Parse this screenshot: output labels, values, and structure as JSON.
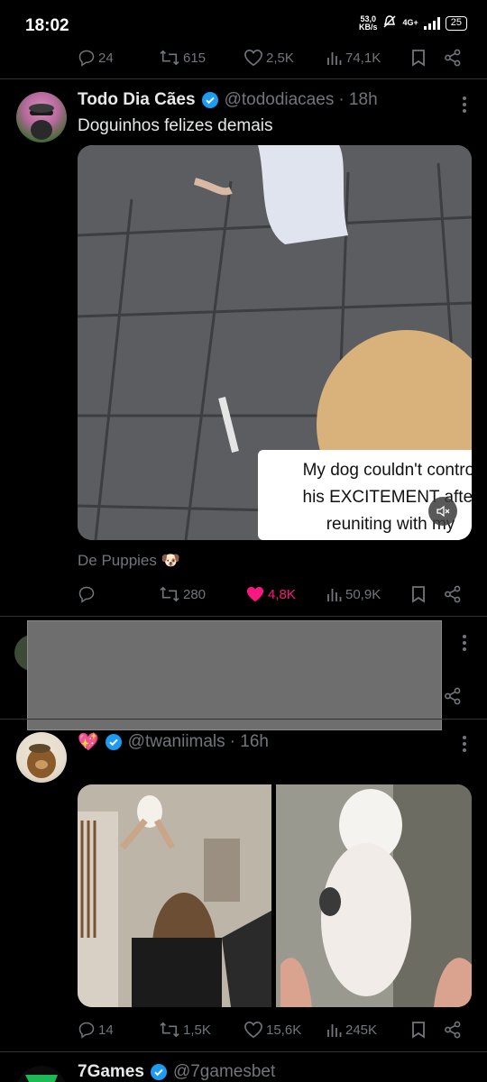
{
  "status": {
    "time": "18:02",
    "netspeed_value": "53,0",
    "netspeed_unit": "KB/s",
    "network": "4G+",
    "battery": "25"
  },
  "tweet0": {
    "replies": "24",
    "retweets": "615",
    "likes": "2,5K",
    "views": "74,1K"
  },
  "tweet1": {
    "name": "Todo Dia Cães",
    "handle": "@tododiacaes",
    "time": "· 18h",
    "text": "Doguinhos felizes demais",
    "video_caption_line1": "My dog couldn't control",
    "video_caption_line2": "his EXCITEMENT after",
    "video_caption_line3": "reuniting with my",
    "source": "De Puppies",
    "replies": "",
    "retweets": "280",
    "likes": "4,8K",
    "views": "50,9K"
  },
  "tweet3": {
    "emoji": "💖",
    "handle": "@twaniimals",
    "time": "· 16h",
    "replies": "14",
    "retweets": "1,5K",
    "likes": "15,6K",
    "views": "245K"
  },
  "tweet4": {
    "name": "7Games",
    "handle": "@7gamesbet"
  },
  "colors": {
    "background": "#000000",
    "text": "#e7e9ea",
    "muted": "#71767b",
    "like_active": "#f91880",
    "verified": "#1d9bf0"
  }
}
